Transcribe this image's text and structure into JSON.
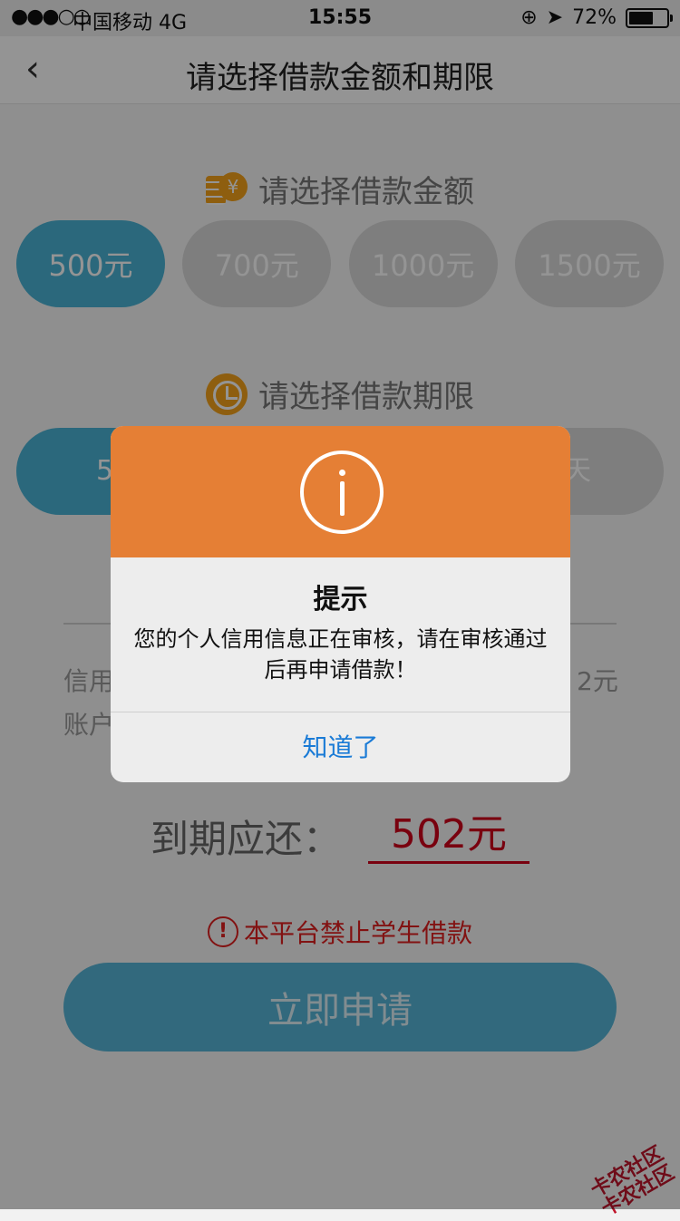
{
  "status_bar": {
    "signal": "●●●○○",
    "carrier": "中国移动  4G",
    "time": "15:55",
    "battery": "72%",
    "battery_level": 0.72
  },
  "nav": {
    "back_icon": "chevron-left-icon",
    "title": "请选择借款金额和期限"
  },
  "amount_section": {
    "title": "请选择借款金额",
    "icon": "coin-stack-icon",
    "options": [
      "500元",
      "700元",
      "1000元",
      "1500元"
    ],
    "selected_index": 0
  },
  "term_section": {
    "title": "请选择借款期限",
    "icon": "clock-icon",
    "left_option_visible": "5",
    "right_option_visible": "天"
  },
  "info_lines": {
    "line1_left": "信用",
    "line1_right": "2元",
    "line2_left": "账户"
  },
  "due": {
    "label": "到期应还：",
    "value": "502元"
  },
  "warning": {
    "icon": "exclamation-circle-icon",
    "text": "本平台禁止学生借款"
  },
  "apply_button": "立即申请",
  "dialog": {
    "icon": "info-icon",
    "title": "提示",
    "message": "您的个人信用信息正在审核，请在审核通过后再申请借款！",
    "ok_label": "知道了"
  },
  "watermark": "卡农社区",
  "colors": {
    "accent_blue": "#4ab3d6",
    "dialog_header": "#e57f35",
    "warning_red": "#e02020",
    "link_blue": "#1a7bd6"
  }
}
